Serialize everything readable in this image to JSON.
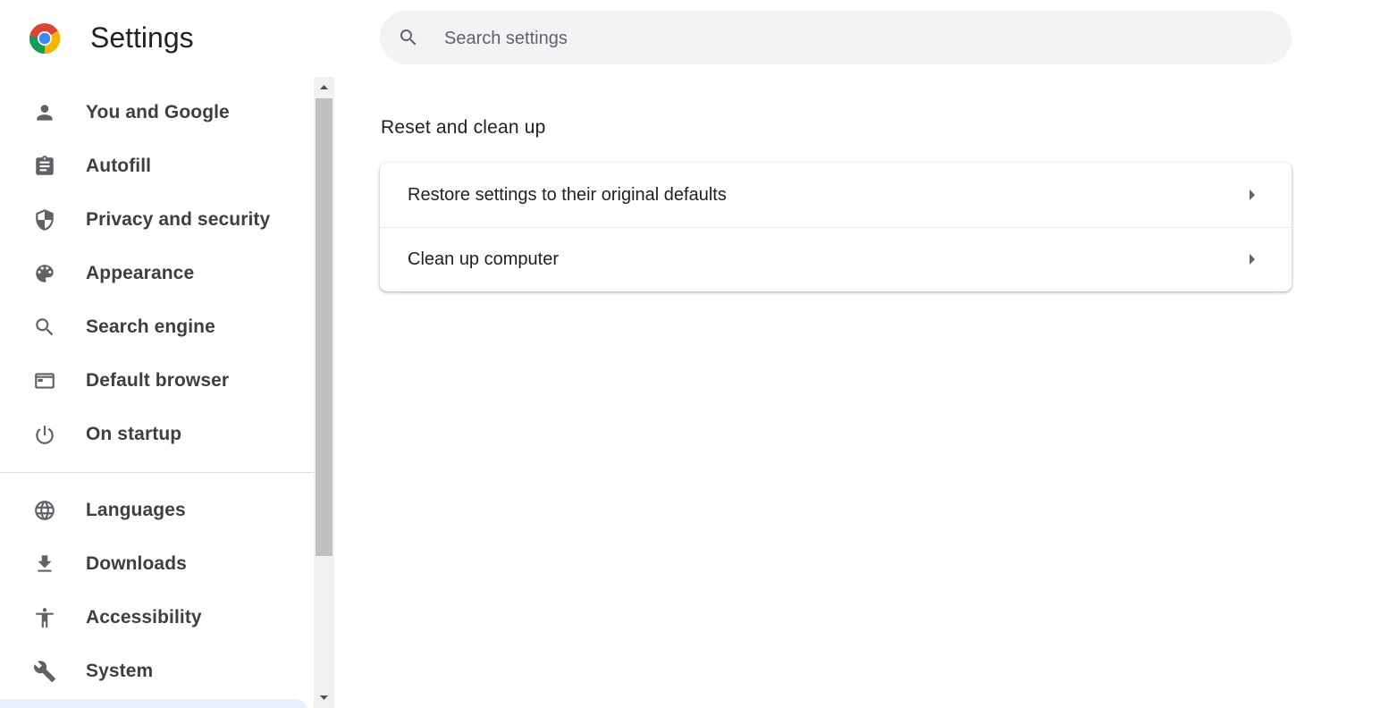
{
  "header": {
    "title": "Settings",
    "logo_icon": "chrome-logo-icon"
  },
  "search": {
    "placeholder": "Search settings",
    "value": "",
    "icon": "search-icon"
  },
  "sidebar": {
    "items": [
      {
        "label": "You and Google",
        "icon": "person-icon"
      },
      {
        "label": "Autofill",
        "icon": "clipboard-icon"
      },
      {
        "label": "Privacy and security",
        "icon": "shield-icon"
      },
      {
        "label": "Appearance",
        "icon": "palette-icon"
      },
      {
        "label": "Search engine",
        "icon": "search-icon"
      },
      {
        "label": "Default browser",
        "icon": "browser-window-icon"
      },
      {
        "label": "On startup",
        "icon": "power-icon"
      },
      {
        "label": "Languages",
        "icon": "globe-icon"
      },
      {
        "label": "Downloads",
        "icon": "download-icon"
      },
      {
        "label": "Accessibility",
        "icon": "accessibility-icon"
      },
      {
        "label": "System",
        "icon": "wrench-icon"
      }
    ]
  },
  "main": {
    "section_title": "Reset and clean up",
    "rows": [
      {
        "label": "Restore settings to their original defaults",
        "icon": "arrow-right-icon"
      },
      {
        "label": "Clean up computer",
        "icon": "arrow-right-icon"
      }
    ]
  },
  "colors": {
    "icon_gray": "#5f6368",
    "label_gray": "#3c4043",
    "search_bg": "#f1f3f4",
    "selected_bg": "#e8f0fe"
  }
}
